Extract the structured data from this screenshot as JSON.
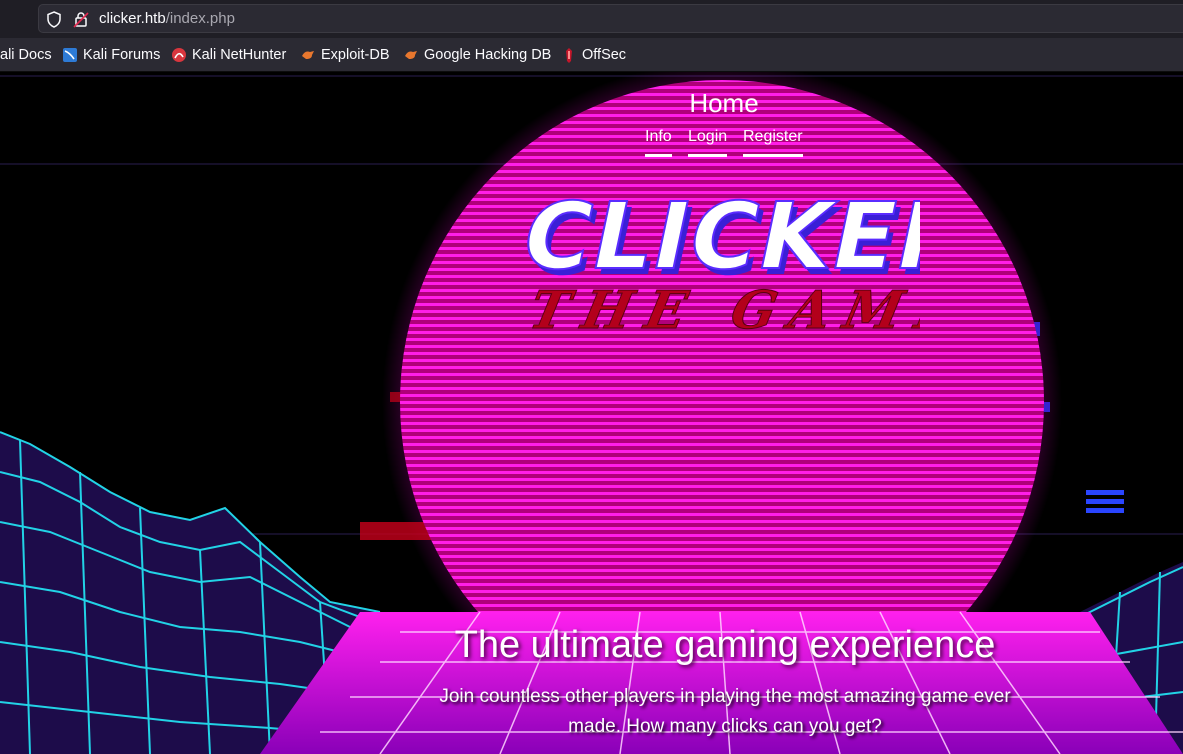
{
  "browser": {
    "url_host": "clicker.htb",
    "url_path": "/index.php",
    "bookmarks": [
      "ali Docs",
      "Kali Forums",
      "Kali NetHunter",
      "Exploit-DB",
      "Google Hacking DB",
      "OffSec"
    ]
  },
  "nav": {
    "title": "Home",
    "links": [
      "Info",
      "Login",
      "Register"
    ]
  },
  "logo": {
    "line1": "CLICKER",
    "line2": "THE GAME"
  },
  "hero": {
    "title": "The ultimate gaming experience",
    "subtitle": "Join countless other players in playing the most amazing game ever made. How many clicks can you get?"
  },
  "colors": {
    "sun": "#ff14e6",
    "grid": "#22d3e6",
    "logo_blue": "#5a2cff",
    "logo_red": "#b3001b"
  }
}
